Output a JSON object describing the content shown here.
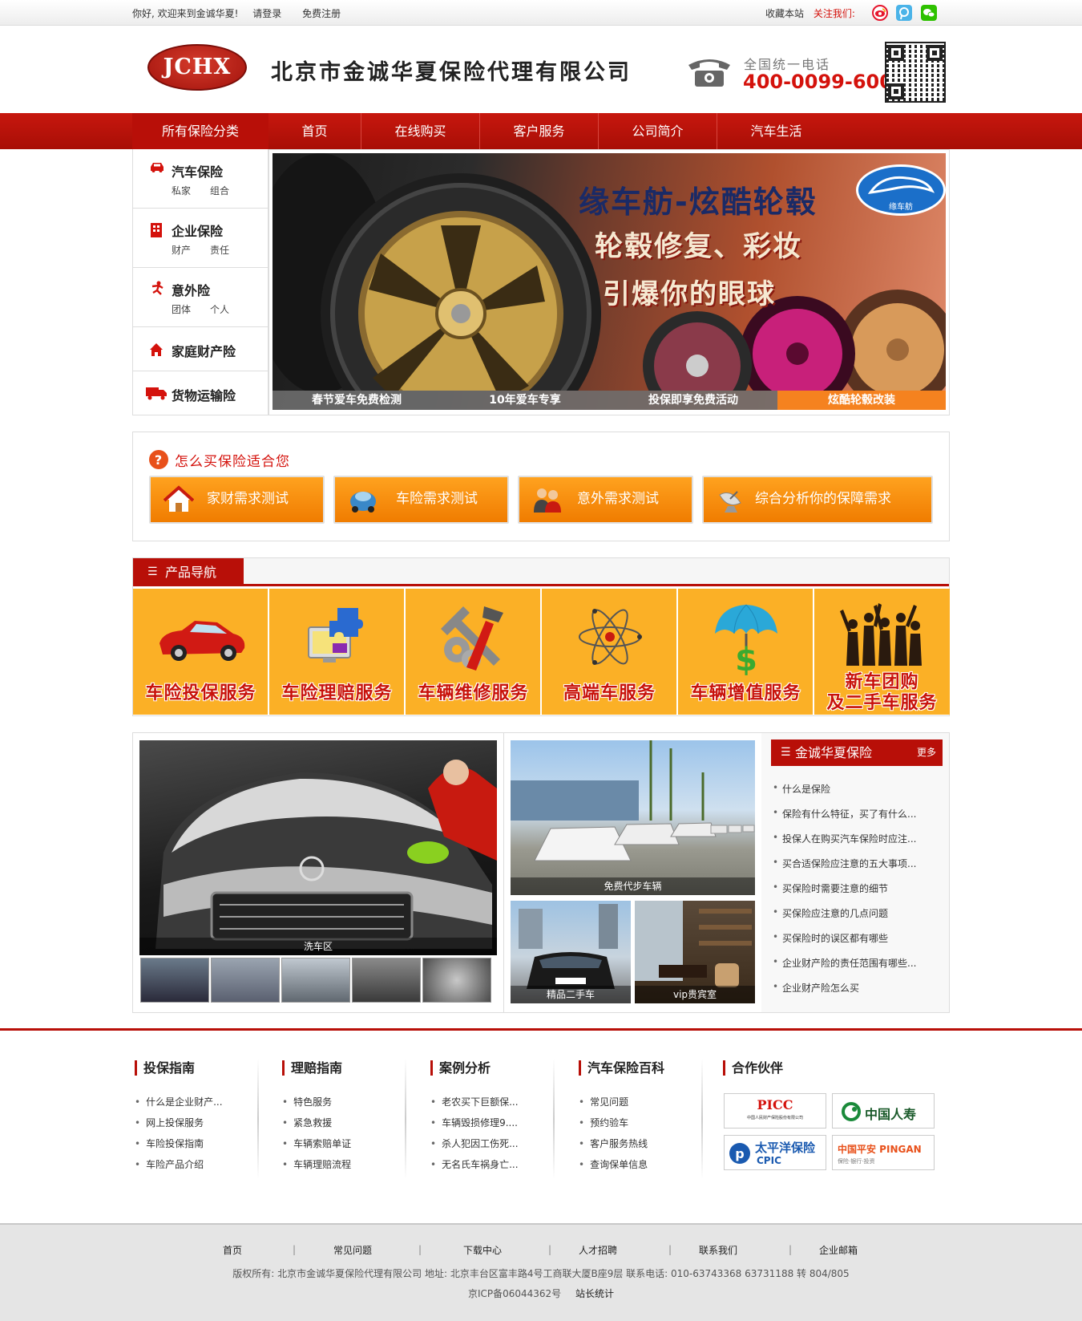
{
  "topbar": {
    "welcome": "你好, 欢迎来到金诚华夏!",
    "login": "请登录",
    "register": "免费注册",
    "favorite": "收藏本站",
    "follow": "关注我们:"
  },
  "header": {
    "logo_text": "JCHX",
    "company_name": "北京市金诚华夏保险代理有限公司",
    "phone_label": "全国统一电话",
    "phone_number": "400-0099-600"
  },
  "nav": {
    "category": "所有保险分类",
    "items": [
      "首页",
      "在线购买",
      "客户服务",
      "公司简介",
      "汽车生活"
    ]
  },
  "categories": [
    {
      "icon": "car-icon",
      "title": "汽车保险",
      "subs": [
        "私家",
        "组合"
      ]
    },
    {
      "icon": "building-icon",
      "title": "企业保险",
      "subs": [
        "财产",
        "责任"
      ]
    },
    {
      "icon": "accident-icon",
      "title": "意外险",
      "subs": [
        "团体",
        "个人"
      ]
    },
    {
      "icon": "house-icon",
      "title": "家庭财产险",
      "subs": []
    },
    {
      "icon": "truck-icon",
      "title": "货物运输险",
      "subs": []
    }
  ],
  "banner": {
    "title": "缘车舫-炫酷轮毂",
    "line1": "轮毂修复、彩妆",
    "line2": "引爆你的眼球",
    "brand": "缘车舫",
    "tabs": [
      "春节爱车免费检测",
      "10年爱车专享",
      "投保即享免费活动",
      "炫酷轮毂改装"
    ],
    "active_tab": 3
  },
  "how_to_buy": {
    "title": "怎么买保险适合您",
    "buttons": [
      {
        "icon": "house-icon",
        "label": "家财需求测试"
      },
      {
        "icon": "car-icon",
        "label": "车险需求测试"
      },
      {
        "icon": "people-icon",
        "label": "意外需求测试"
      },
      {
        "icon": "satellite-icon",
        "label": "综合分析你的保障需求"
      }
    ]
  },
  "product_nav": {
    "title": "产品导航",
    "items": [
      {
        "icon": "red-car-icon",
        "label": "车险投保服务",
        "label2": ""
      },
      {
        "icon": "puzzle-computer-icon",
        "label": "车险理赔服务",
        "label2": ""
      },
      {
        "icon": "tools-icon",
        "label": "车辆维修服务",
        "label2": ""
      },
      {
        "icon": "atom-icon",
        "label": "高端车服务",
        "label2": ""
      },
      {
        "icon": "umbrella-dollar-icon",
        "label": "车辆增值服务",
        "label2": ""
      },
      {
        "icon": "crowd-icon",
        "label": "新车团购",
        "label2": "及二手车服务"
      }
    ]
  },
  "gallery": {
    "main_caption": "洗车区",
    "side_caption": "免费代步车辆",
    "small1_caption": "精品二手车",
    "small2_caption": "vip贵宾室"
  },
  "news": {
    "title": "金诚华夏保险",
    "more": "更多",
    "items": [
      "什么是保险",
      "保险有什么特征，买了有什么...",
      "投保人在购买汽车保险时应注...",
      "买合适保险应注意的五大事项...",
      "买保险时需要注意的细节",
      "买保险应注意的几点问题",
      "买保险时的误区都有哪些",
      "企业财产险的责任范围有哪些...",
      "企业财产险怎么买"
    ]
  },
  "footer_cols": [
    {
      "title": "投保指南",
      "items": [
        "什么是企业财产...",
        "网上投保服务",
        "车险投保指南",
        "车险产品介绍"
      ]
    },
    {
      "title": "理赔指南",
      "items": [
        "特色服务",
        "紧急救援",
        "车辆索赔单证",
        "车辆理赔流程"
      ]
    },
    {
      "title": "案例分析",
      "items": [
        "老农买下巨额保...",
        "车辆毁损修理9....",
        "杀人犯因工伤死...",
        "无名氏车祸身亡..."
      ]
    },
    {
      "title": "汽车保险百科",
      "items": [
        "常见问题",
        "预约验车",
        "客户服务热线",
        "查询保单信息"
      ]
    }
  ],
  "partners": {
    "title": "合作伙伴",
    "logos": [
      {
        "name": "PICC",
        "sub": "中国人民财产保险股份有限公司"
      },
      {
        "name": "中国人寿",
        "sub": ""
      },
      {
        "name": "太平洋保险",
        "sub": "CPIC"
      },
      {
        "name": "中国平安 PINGAN",
        "sub": "保险·银行·投资"
      }
    ]
  },
  "bottom": {
    "links": [
      "首页",
      "常见问题",
      "下载中心",
      "人才招聘",
      "联系我们",
      "企业邮箱"
    ],
    "separator": "|",
    "copyright": "版权所有: 北京市金诚华夏保险代理有限公司  地址: 北京丰台区富丰路4号工商联大厦B座9层  联系电话: 010-63743368 63731188 转 804/805",
    "icp": "京ICP备06044362号",
    "stats": "站长统计"
  },
  "colors": {
    "brand_red": "#b80f08",
    "orange": "#f07c00",
    "yellow": "#fbb026"
  }
}
